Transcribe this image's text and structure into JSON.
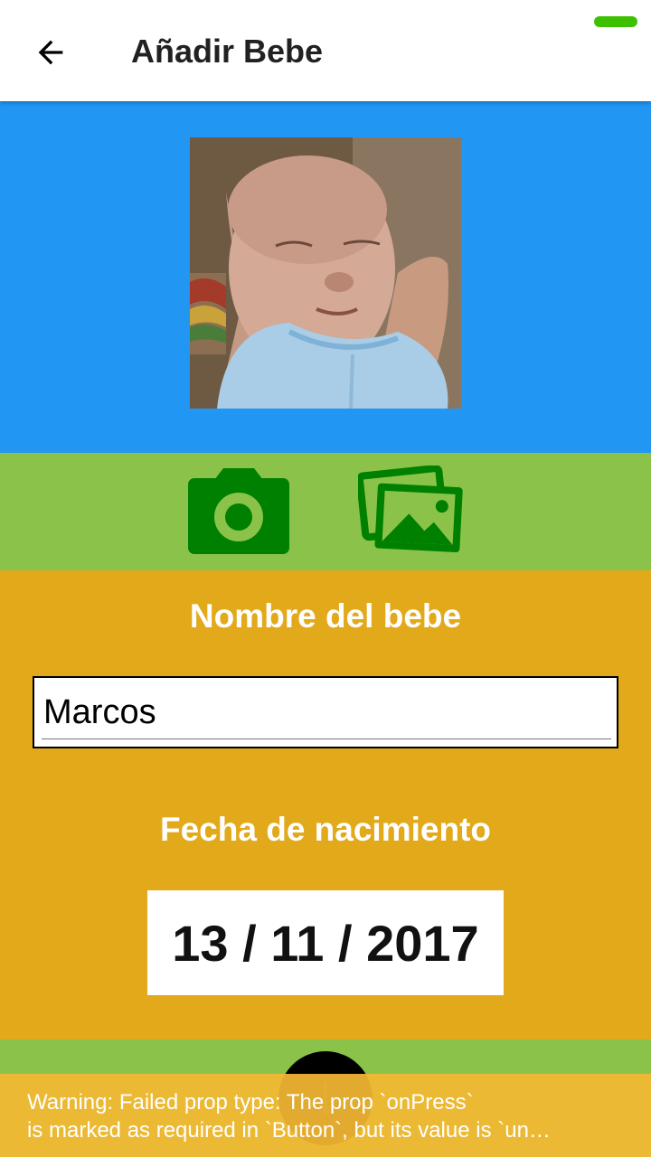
{
  "header": {
    "title": "Añadir Bebe",
    "back_icon": "arrow-back-icon"
  },
  "status_indicator_color": "#3dc000",
  "colors": {
    "photo_bg": "#2196f3",
    "actions_bg": "#8bc34a",
    "form_bg": "#e2a91b",
    "icon_green": "#008000",
    "warning_bg": "#f3b833"
  },
  "photo": {
    "icon": "baby-photo"
  },
  "actions": {
    "camera_icon": "camera-icon",
    "gallery_icon": "gallery-icon"
  },
  "form": {
    "name_label": "Nombre del bebe",
    "name_value": "Marcos",
    "date_label": "Fecha de nacimiento",
    "date_value": "13 / 11 / 2017"
  },
  "warning": {
    "line1": "Warning: Failed prop type: The prop `onPress`",
    "line2": "is marked as required in `Button`, but its value is `un…"
  }
}
